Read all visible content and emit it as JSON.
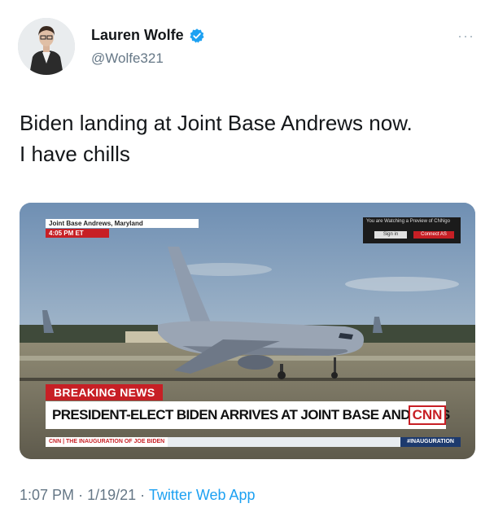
{
  "user": {
    "name": "Lauren Wolfe",
    "handle": "@Wolfe321"
  },
  "tweet": {
    "line1": "Biden landing at Joint Base Andrews now.",
    "line2": "I have chills"
  },
  "media": {
    "location": "Joint Base Andrews, Maryland",
    "time": "4:05 PM ET",
    "preview_notice": "You are Watching a Preview of CNNgo",
    "preview_sign_in": "Sign in",
    "preview_connect": "Connect AS",
    "breaking_label": "BREAKING NEWS",
    "headline": "PRESIDENT-ELECT BIDEN ARRIVES AT JOINT BASE ANDREWS",
    "logo": "CNN",
    "ticker_left": "CNN | THE INAUGURATION OF JOE BIDEN",
    "ticker_right": "#INAUGURATION"
  },
  "footer": {
    "time": "1:07 PM",
    "date": "1/19/21",
    "app": "Twitter Web App",
    "separator": "·"
  },
  "colors": {
    "verified": "#1da1f2",
    "cnn_red": "#c71f25",
    "muted": "#657786"
  }
}
